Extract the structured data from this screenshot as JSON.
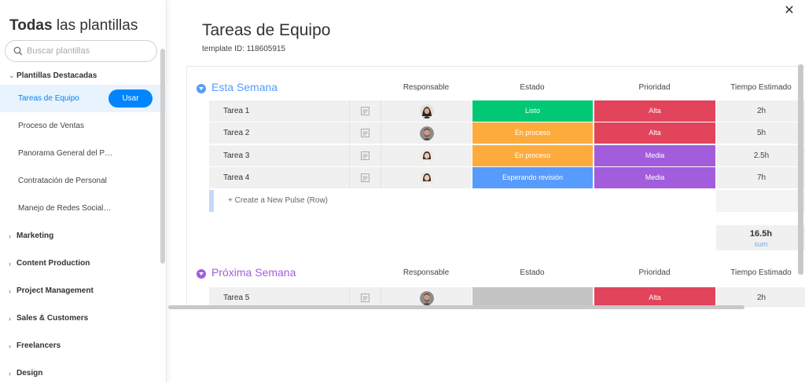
{
  "sidebar": {
    "title_bold": "Todas",
    "title_rest": " las plantillas",
    "search_placeholder": "Buscar plantillas",
    "featured_label": "Plantillas Destacadas",
    "templates": [
      {
        "label": "Tareas de Equipo",
        "active": true
      },
      {
        "label": "Proceso de Ventas"
      },
      {
        "label": "Panorama General del P…"
      },
      {
        "label": "Contratación de Personal"
      },
      {
        "label": "Manejo de Redes Social…"
      }
    ],
    "use_button": "Usar",
    "categories": [
      "Marketing",
      "Content Production",
      "Project Management",
      "Sales & Customers",
      "Freelancers",
      "Design"
    ]
  },
  "main": {
    "title": "Tareas de Equipo",
    "template_id": "template ID: 118605915",
    "close_icon": "close-icon"
  },
  "columns": {
    "responsible": "Responsable",
    "status": "Estado",
    "priority": "Prioridad",
    "time": "Tiempo Estimado"
  },
  "colors": {
    "blue_group": "#579bfc",
    "purple_group": "#a25ddc",
    "listo": "#00c875",
    "en_proceso": "#fdab3d",
    "esperando": "#579bfc",
    "alta": "#e2445c",
    "media": "#a25ddc",
    "empty": "#c4c4c4",
    "accent": "#0085ff"
  },
  "groups": [
    {
      "name": "Esta Semana",
      "rows": [
        {
          "task": "Tarea 1",
          "status": "Listo",
          "status_color": "#00c875",
          "priority": "Alta",
          "priority_color": "#e2445c",
          "time": "2h",
          "avatar": "woman-dark"
        },
        {
          "task": "Tarea 2",
          "status": "En proceso",
          "status_color": "#fdab3d",
          "priority": "Alta",
          "priority_color": "#e2445c",
          "time": "5h",
          "avatar": "man-beard"
        },
        {
          "task": "Tarea 3",
          "status": "En proceso",
          "status_color": "#fdab3d",
          "priority": "Media",
          "priority_color": "#a25ddc",
          "time": "2.5h",
          "avatar": "woman-light"
        },
        {
          "task": "Tarea 4",
          "status": "Esperando revisión",
          "status_color": "#579bfc",
          "priority": "Media",
          "priority_color": "#a25ddc",
          "time": "7h",
          "avatar": "woman-light"
        }
      ],
      "new_row": "+ Create a New Pulse (Row)",
      "sum_value": "16.5h",
      "sum_label": "sum"
    },
    {
      "name": "Próxima Semana",
      "rows": [
        {
          "task": "Tarea 5",
          "status": "",
          "status_color": "#c4c4c4",
          "priority": "Alta",
          "priority_color": "#e2445c",
          "time": "2h",
          "avatar": "man-beard"
        }
      ]
    }
  ]
}
